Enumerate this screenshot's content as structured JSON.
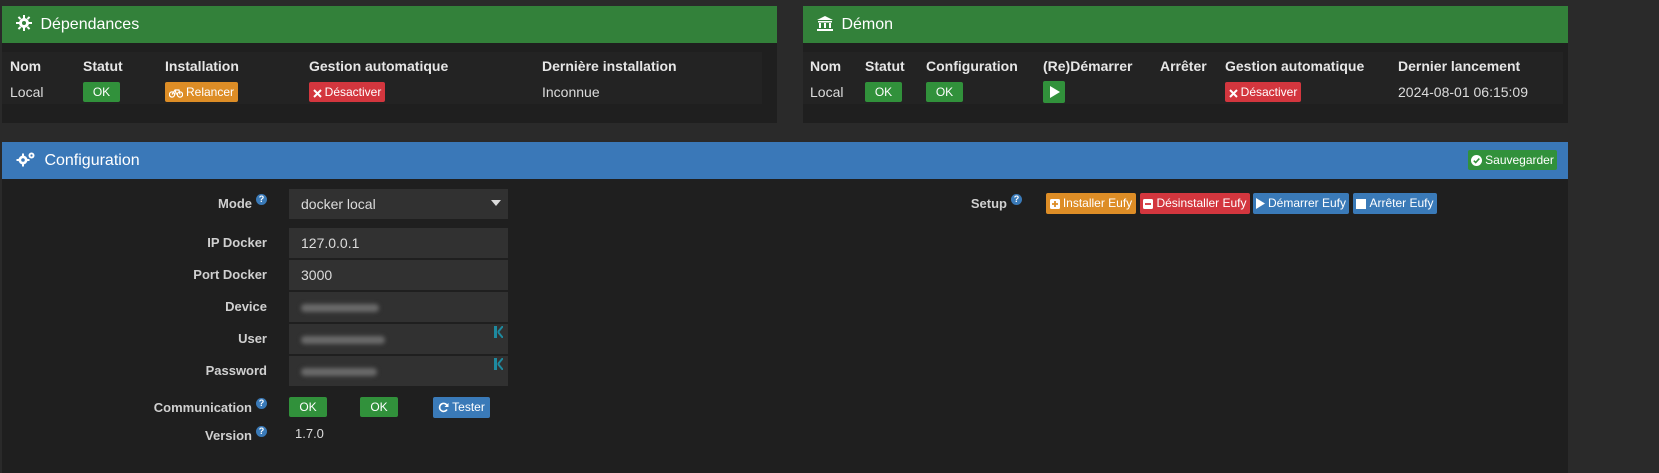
{
  "deps": {
    "title": "Dépendances",
    "headers": [
      "Nom",
      "Statut",
      "Installation",
      "Gestion automatique",
      "Dernière installation"
    ],
    "row": {
      "name": "Local",
      "status": "OK",
      "install_btn": "Relancer",
      "auto_btn": "Désactiver",
      "last_install": "Inconnue"
    }
  },
  "daemon": {
    "title": "Démon",
    "headers": [
      "Nom",
      "Statut",
      "Configuration",
      "(Re)Démarrer",
      "Arrêter",
      "Gestion automatique",
      "Dernier lancement"
    ],
    "row": {
      "name": "Local",
      "status": "OK",
      "config": "OK",
      "auto_btn": "Désactiver",
      "last_launch": "2024-08-01 06:15:09"
    }
  },
  "config": {
    "title": "Configuration",
    "save_btn": "Sauvegarder",
    "mode_label": "Mode",
    "mode_value": "docker local",
    "ip_label": "IP Docker",
    "ip_value": "127.0.0.1",
    "port_label": "Port Docker",
    "port_value": "3000",
    "device_label": "Device",
    "user_label": "User",
    "password_label": "Password",
    "comm_label": "Communication",
    "comm_status1": "OK",
    "comm_status2": "OK",
    "test_btn": "Tester",
    "version_label": "Version",
    "version_value": "1.7.0",
    "setup_label": "Setup",
    "setup_buttons": {
      "install": "Installer Eufy",
      "uninstall": "Désinstaller Eufy",
      "start": "Démarrer Eufy",
      "stop": "Arrêter Eufy"
    },
    "help_glyph": "?"
  },
  "colors": {
    "header_green": "#33813a",
    "header_blue": "#3a78b8",
    "ok_green": "#31913b",
    "warn_orange": "#dd8d26",
    "danger_red": "#d3363e",
    "info_blue": "#3a7ab8"
  }
}
